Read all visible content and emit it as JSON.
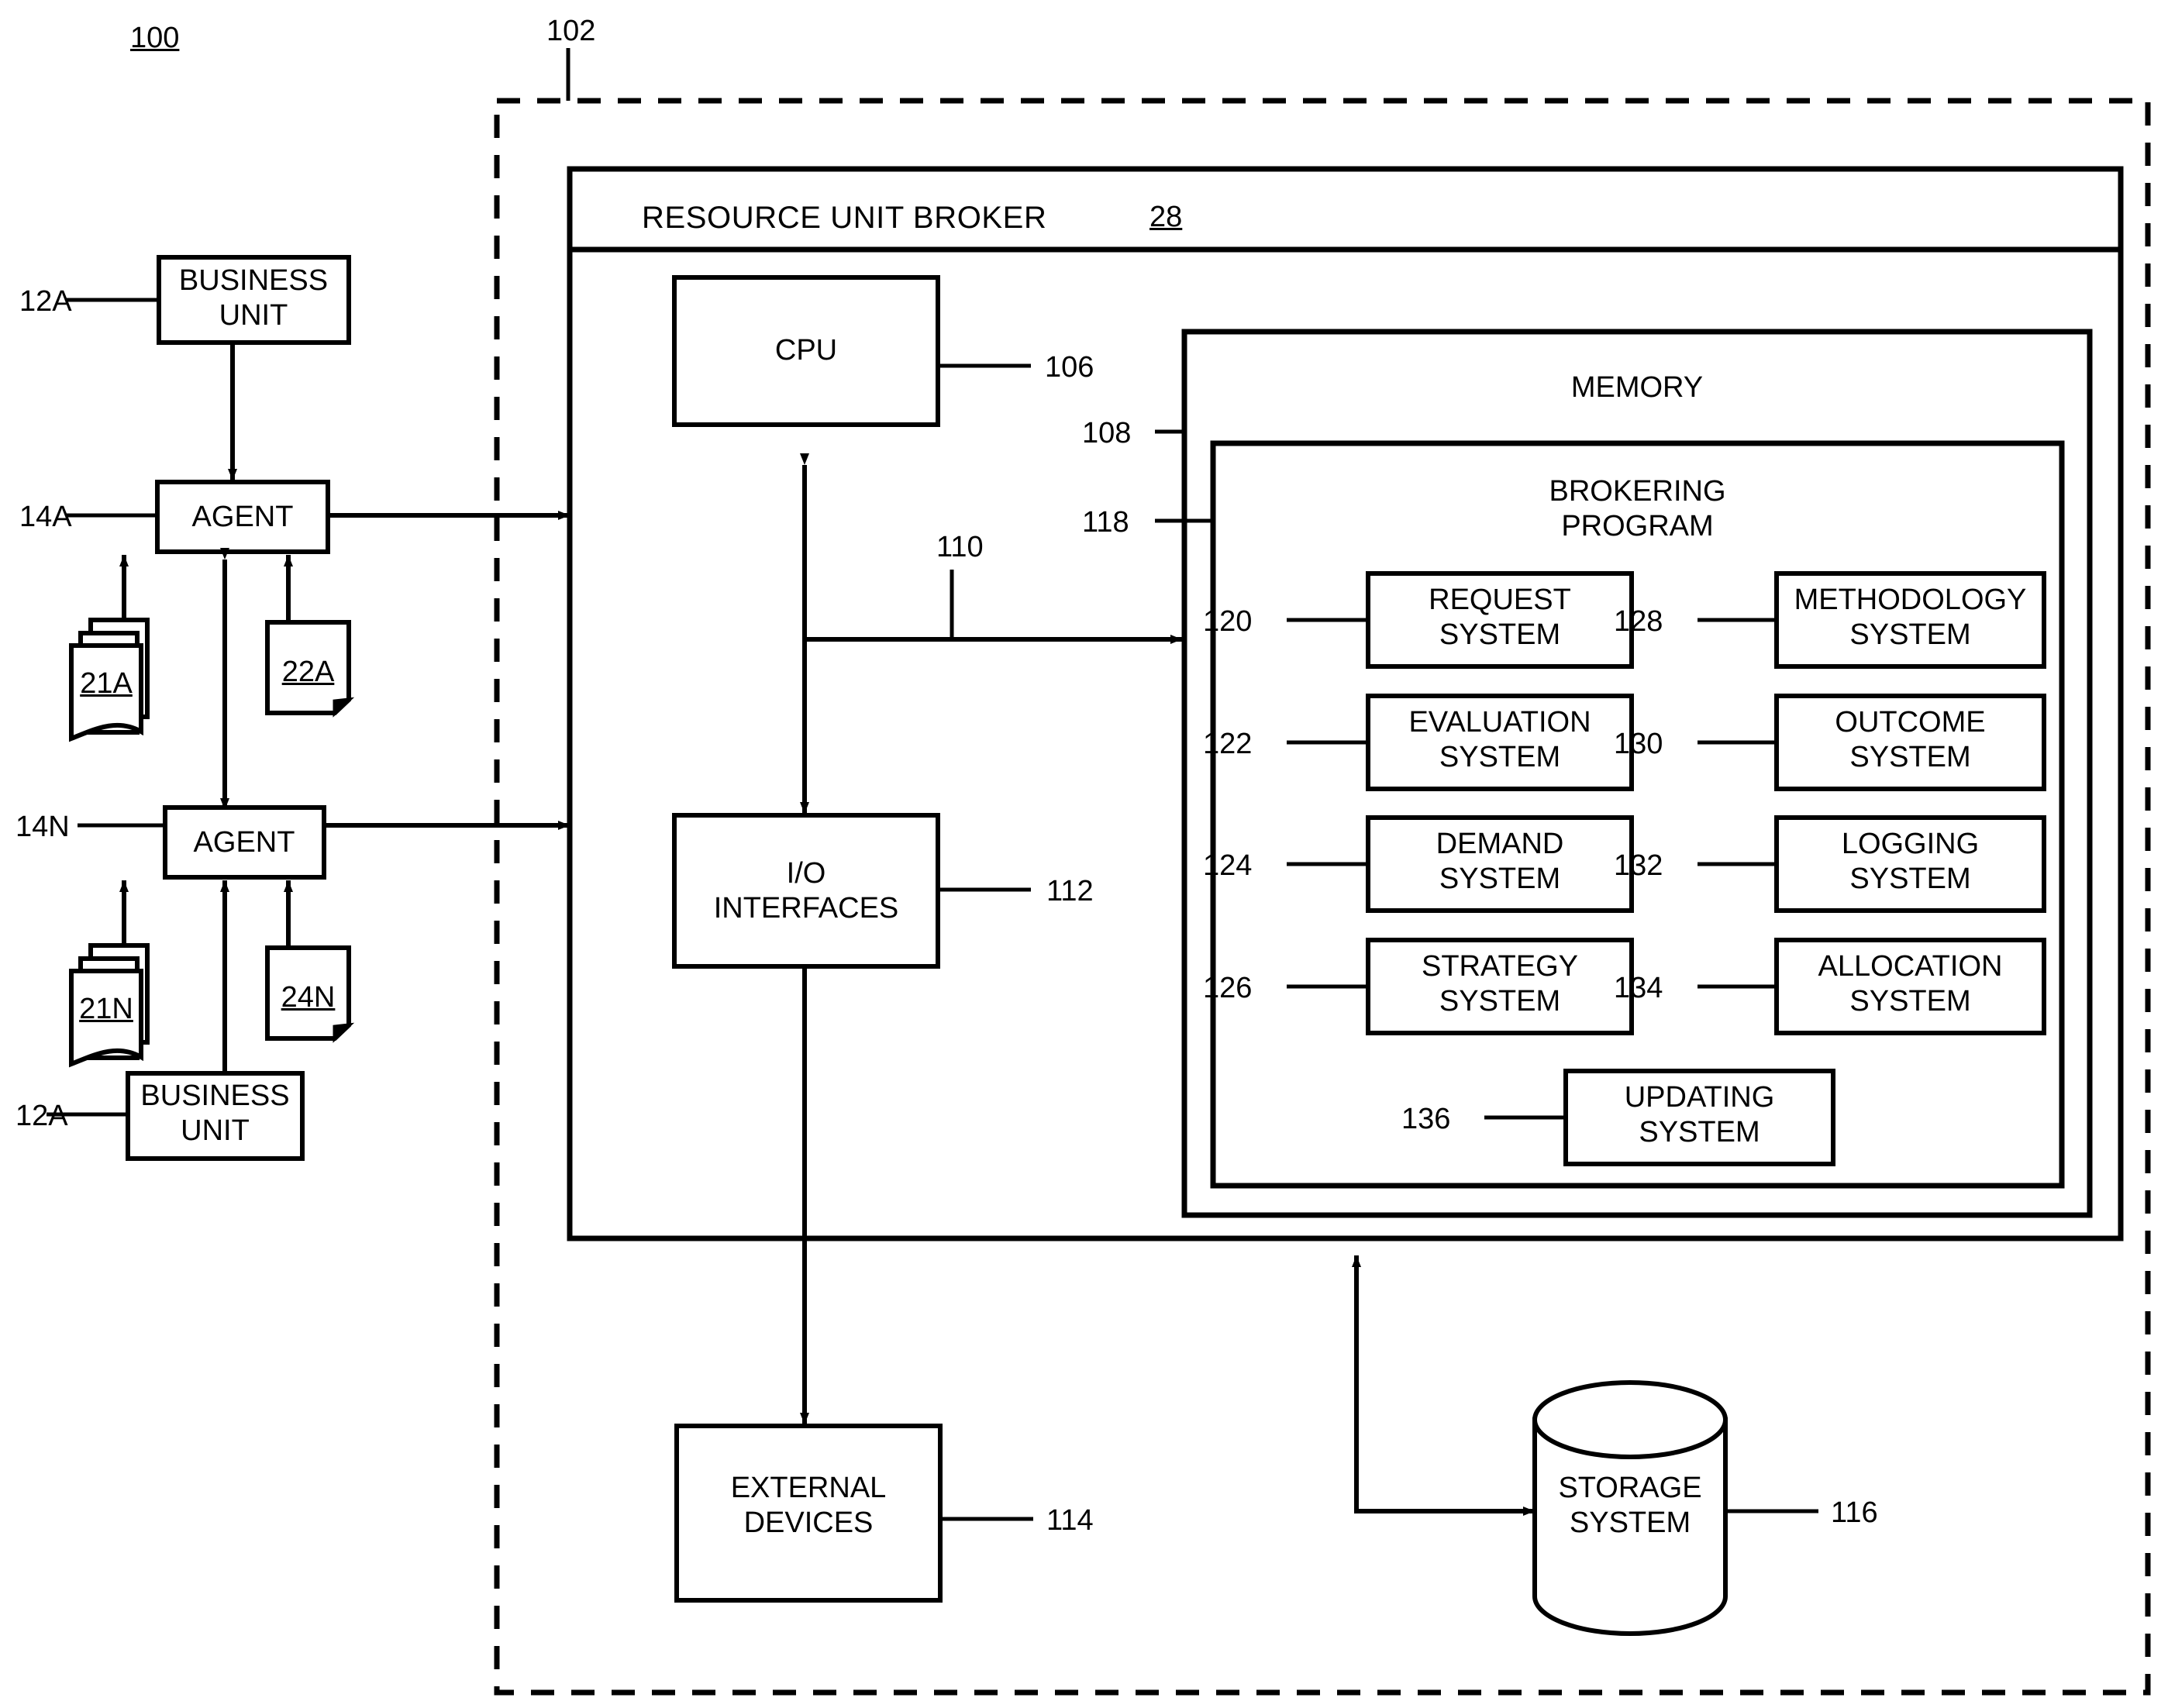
{
  "figure": {
    "figure_number": "100",
    "enclosure_ref": "102"
  },
  "left_column": {
    "business_unit_top": {
      "label": "BUSINESS\nUNIT",
      "ref": "12A"
    },
    "agent_top": {
      "label": "AGENT",
      "ref": "14A"
    },
    "docs_top": {
      "label": "21A"
    },
    "doc_single_top": {
      "label": "22A"
    },
    "agent_bottom": {
      "label": "AGENT",
      "ref": "14N"
    },
    "docs_bottom": {
      "label": "21N"
    },
    "doc_single_bottom": {
      "label": "24N"
    },
    "business_unit_bottom": {
      "label": "BUSINESS\nUNIT",
      "ref": "12A"
    }
  },
  "broker": {
    "title": "RESOURCE UNIT BROKER",
    "title_ref": "28",
    "cpu": {
      "label": "CPU",
      "ref": "106"
    },
    "io": {
      "label": "I/O\nINTERFACES",
      "ref": "112"
    },
    "bus_ref": "110",
    "memory": {
      "label": "MEMORY",
      "ref": "108"
    },
    "brokering_program": {
      "label": "BROKERING\nPROGRAM",
      "ref": "118"
    },
    "systems_left": [
      {
        "ref": "120",
        "label": "REQUEST\nSYSTEM"
      },
      {
        "ref": "122",
        "label": "EVALUATION\nSYSTEM"
      },
      {
        "ref": "124",
        "label": "DEMAND\nSYSTEM"
      },
      {
        "ref": "126",
        "label": "STRATEGY\nSYSTEM"
      }
    ],
    "systems_right": [
      {
        "ref": "128",
        "label": "METHODOLOGY\nSYSTEM"
      },
      {
        "ref": "130",
        "label": "OUTCOME\nSYSTEM"
      },
      {
        "ref": "132",
        "label": "LOGGING\nSYSTEM"
      },
      {
        "ref": "134",
        "label": "ALLOCATION\nSYSTEM"
      }
    ],
    "systems_center": [
      {
        "ref": "136",
        "label": "UPDATING\nSYSTEM"
      }
    ]
  },
  "peripherals": {
    "external_devices": {
      "label": "EXTERNAL\nDEVICES",
      "ref": "114"
    },
    "storage_system": {
      "label": "STORAGE\nSYSTEM",
      "ref": "116"
    }
  },
  "style": {
    "ink": "#000000",
    "paper": "#ffffff"
  }
}
